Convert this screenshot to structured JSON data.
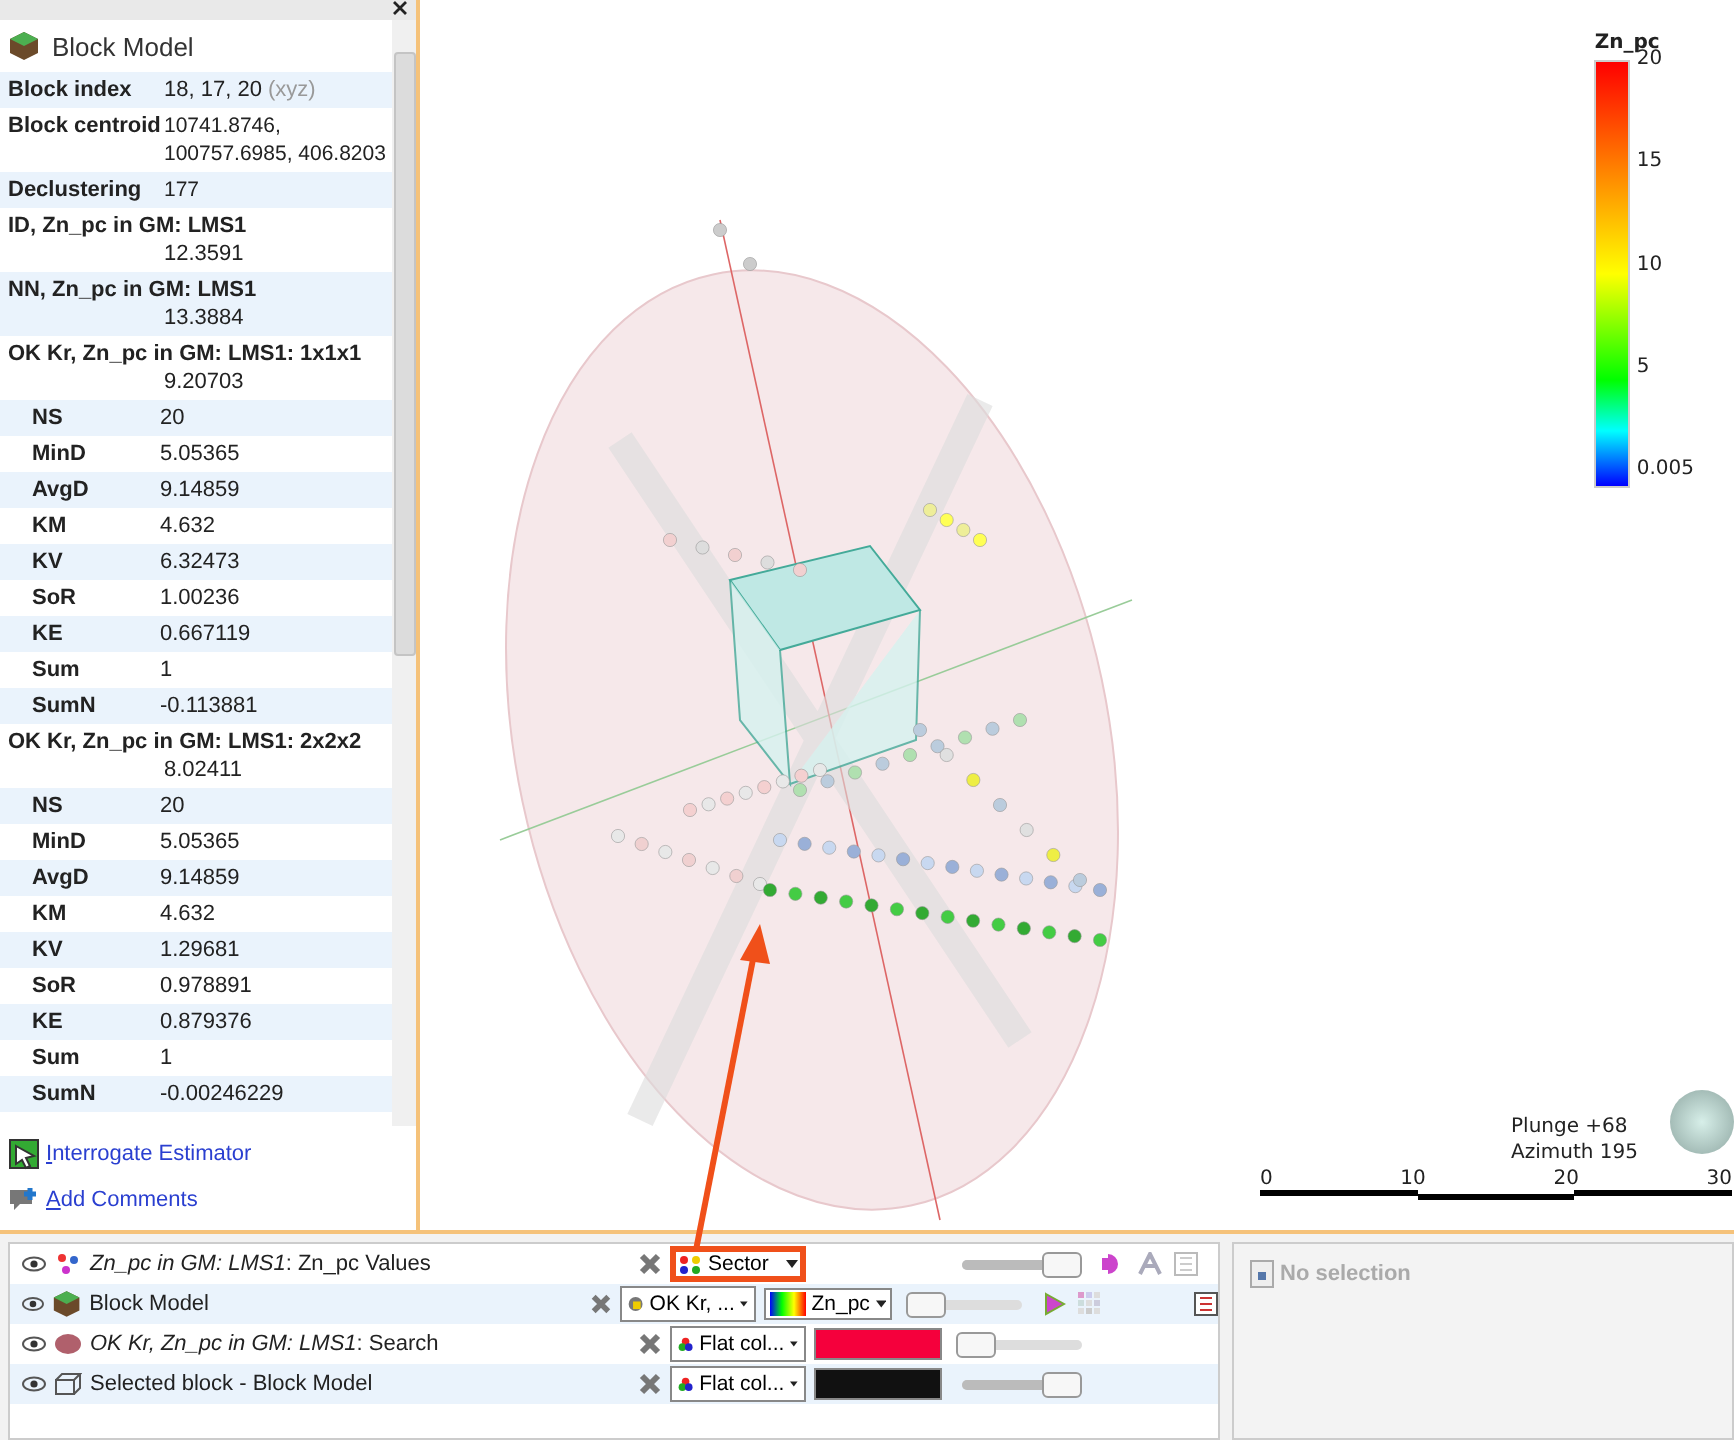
{
  "inspector": {
    "title": "Block Model",
    "rows": [
      {
        "kind": "field",
        "label": "Block index",
        "value": "18, 17, 20",
        "note": "(xyz)"
      },
      {
        "kind": "field",
        "label": "Block centroid",
        "value": "10741.8746, 100757.6985, 406.8203"
      },
      {
        "kind": "field",
        "label": "Declustering",
        "value": "177"
      },
      {
        "kind": "heading",
        "label": "ID, Zn_pc in GM: LMS1",
        "value": "12.3591"
      },
      {
        "kind": "heading",
        "label": "NN, Zn_pc in GM: LMS1",
        "value": "13.3884"
      },
      {
        "kind": "heading",
        "label": "OK Kr, Zn_pc in GM: LMS1: 1x1x1",
        "value": "9.20703"
      },
      {
        "kind": "sub",
        "label": "NS",
        "value": "20"
      },
      {
        "kind": "sub",
        "label": "MinD",
        "value": "5.05365"
      },
      {
        "kind": "sub",
        "label": "AvgD",
        "value": "9.14859"
      },
      {
        "kind": "sub",
        "label": "KM",
        "value": "4.632"
      },
      {
        "kind": "sub",
        "label": "KV",
        "value": "6.32473"
      },
      {
        "kind": "sub",
        "label": "SoR",
        "value": "1.00236"
      },
      {
        "kind": "sub",
        "label": "KE",
        "value": "0.667119"
      },
      {
        "kind": "sub",
        "label": "Sum",
        "value": "1"
      },
      {
        "kind": "sub",
        "label": "SumN",
        "value": "-0.113881"
      },
      {
        "kind": "heading",
        "label": "OK Kr, Zn_pc in GM: LMS1: 2x2x2",
        "value": "8.02411"
      },
      {
        "kind": "sub",
        "label": "NS",
        "value": "20"
      },
      {
        "kind": "sub",
        "label": "MinD",
        "value": "5.05365"
      },
      {
        "kind": "sub",
        "label": "AvgD",
        "value": "9.14859"
      },
      {
        "kind": "sub",
        "label": "KM",
        "value": "4.632"
      },
      {
        "kind": "sub",
        "label": "KV",
        "value": "1.29681"
      },
      {
        "kind": "sub",
        "label": "SoR",
        "value": "0.978891"
      },
      {
        "kind": "sub",
        "label": "KE",
        "value": "0.879376"
      },
      {
        "kind": "sub",
        "label": "Sum",
        "value": "1"
      },
      {
        "kind": "sub",
        "label": "SumN",
        "value": "-0.00246229"
      }
    ],
    "links": [
      {
        "kind": "interrogate",
        "label": "Interrogate Estimator"
      },
      {
        "kind": "comment",
        "label": "Add Comments"
      }
    ]
  },
  "legend": {
    "title": "Zn_pc",
    "ticks": [
      "20",
      "15",
      "10",
      "5",
      "0.005"
    ]
  },
  "orientation": {
    "plunge": "Plunge +68",
    "azimuth": "Azimuth 195"
  },
  "scale_bar": [
    "0",
    "10",
    "20",
    "30"
  ],
  "layers": [
    {
      "name": "*Zn_pc in GM: LMS1*: Zn_pc Values",
      "style": "Sector",
      "highlighted": true,
      "level": 0.85
    },
    {
      "name": "Block Model",
      "style": "OK Kr, ...",
      "highlighted": false,
      "swatch": {
        "kind": "gradient",
        "label": "Zn_pc"
      },
      "level": 0.1
    },
    {
      "name": "*OK Kr, Zn_pc in GM: LMS1*: Search",
      "style": "Flat col...",
      "highlighted": false,
      "swatch": {
        "kind": "solid",
        "color": "#f5003c"
      },
      "level": 0.1
    },
    {
      "name": "Selected block - Block Model",
      "style": "Flat col...",
      "highlighted": false,
      "swatch": {
        "kind": "solid",
        "color": "#111111"
      },
      "level": 0.85
    }
  ],
  "properties": {
    "message": "No selection"
  }
}
